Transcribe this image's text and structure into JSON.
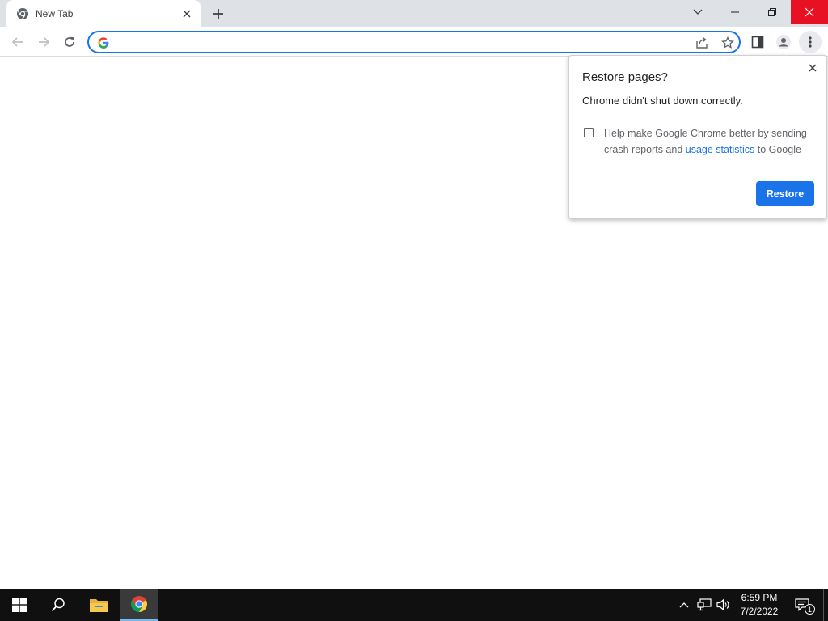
{
  "tab": {
    "title": "New Tab",
    "favicon": "chrome-icon"
  },
  "window": {
    "close_color": "#e81123"
  },
  "omnibox": {
    "value": "",
    "placeholder": ""
  },
  "accent": "#1a73e8",
  "bubble": {
    "title": "Restore pages?",
    "message": "Chrome didn't shut down correctly.",
    "option_text_before": "Help make Google Chrome better by sending crash reports and",
    "option_link": "usage statistics",
    "option_text_after": "to Google",
    "option_checked": false,
    "restore_label": "Restore"
  },
  "taskbar": {
    "time": "6:59 PM",
    "date": "7/2/2022",
    "notification_count": "1",
    "apps": [
      "start-icon",
      "search-icon",
      "file-explorer-icon",
      "chrome-icon"
    ]
  }
}
